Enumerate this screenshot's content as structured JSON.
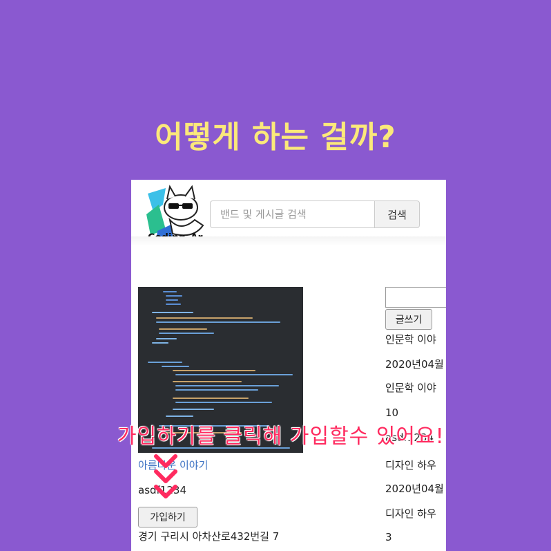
{
  "heading": "어떻게 하는 걸까?",
  "logo": {
    "text": "Coding_Ar"
  },
  "search": {
    "placeholder": "밴드 및 게시글 검색",
    "button_label": "검색"
  },
  "band": {
    "link_text": "아름다운 이야기",
    "user": "asdf1234",
    "join_label": "가입하기",
    "address": "경기 구리시 아차산로432번길 7"
  },
  "right_column": {
    "write_label": "글쓰기",
    "items": [
      "인문학 이야",
      "2020년04월",
      "인문학 이야",
      "10",
      "asdf1234",
      "디자인 하우",
      "2020년04월",
      "디자인 하우",
      "3"
    ]
  },
  "overlay": {
    "text": "가입하기를 클릭해 가입할수 있어요!"
  },
  "colors": {
    "background": "#8a59d0",
    "heading": "#fbe97a",
    "overlay": "#ff2a5f",
    "link": "#3f74c4"
  },
  "icons": [
    "cat-logo-icon",
    "chevron-down-icon"
  ]
}
